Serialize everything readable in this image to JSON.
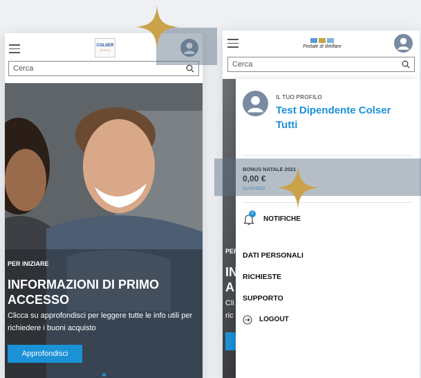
{
  "left_screen": {
    "logo_text": "COLSER",
    "logo_sub": "SERVIZI",
    "search_placeholder": "Cerca",
    "hero": {
      "kicker": "PER INIZIARE",
      "title": "INFORMAZIONI DI PRIMO ACCESSO",
      "body": "Clicca su approfondisci per leggere tutte le info utili per richiedere i buoni acquisto",
      "button_label": "Approfondisci"
    }
  },
  "right_screen": {
    "portal_title": "Portale di Welfare",
    "search_placeholder": "Cerca",
    "profile": {
      "caption": "IL TUO PROFILO",
      "name": "Test Dipendente Colser Tutti"
    },
    "bonus": {
      "title": "BONUS NATALE 2021",
      "amount": "0,00 €",
      "date": "31/10/2022"
    },
    "notifications": {
      "label": "NOTIFICHE",
      "badge": "0"
    },
    "menu": [
      "DATI PERSONALI",
      "RICHIESTE",
      "SUPPORTO"
    ],
    "logout_label": "LOGOUT",
    "bg_fragments": {
      "kicker": "PER",
      "title": "IN A",
      "body": "Cli ric"
    }
  },
  "colors": {
    "accent": "#1b91d6",
    "profile_name": "#1b91d6",
    "avatar": "#7a8aa0",
    "sparkle": "#c9a24a"
  },
  "icons": [
    "hamburger-icon",
    "search-icon",
    "user-avatar-icon",
    "bell-icon",
    "logout-icon",
    "sparkle-icon"
  ]
}
